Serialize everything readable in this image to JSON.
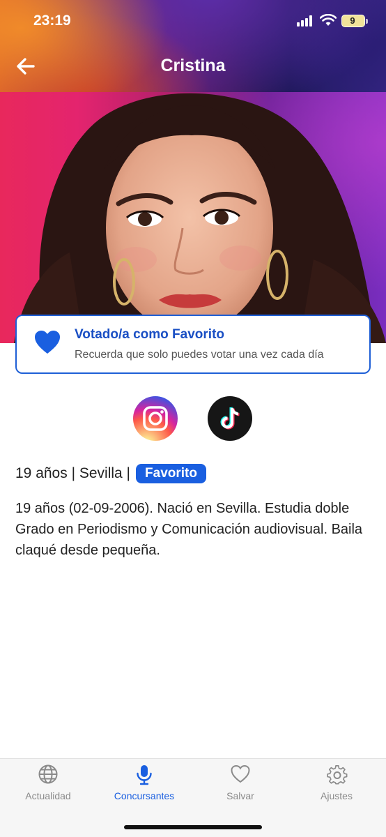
{
  "status_bar": {
    "time": "23:19",
    "battery": "9"
  },
  "header": {
    "title": "Cristina"
  },
  "favorite_card": {
    "title": "Votado/a como Favorito",
    "subtitle": "Recuerda que solo puedes votar una vez cada día"
  },
  "social": {
    "instagram_icon": "instagram-icon",
    "tiktok_icon": "tiktok-icon"
  },
  "info": {
    "age_location": "19 años | Sevilla |",
    "badge": "Favorito",
    "bio": "19 años (02-09-2006).  Nació en Sevilla. Estudia doble Grado en Periodismo y Comunicación audiovisual. Baila claqué desde pequeña."
  },
  "tabs": [
    {
      "label": "Actualidad",
      "icon": "globe-icon",
      "active": false
    },
    {
      "label": "Concursantes",
      "icon": "microphone-icon",
      "active": true
    },
    {
      "label": "Salvar",
      "icon": "heart-icon",
      "active": false
    },
    {
      "label": "Ajustes",
      "icon": "gear-icon",
      "active": false
    }
  ],
  "colors": {
    "accent": "#1a5fe0",
    "inactive": "#8a8a8a"
  }
}
